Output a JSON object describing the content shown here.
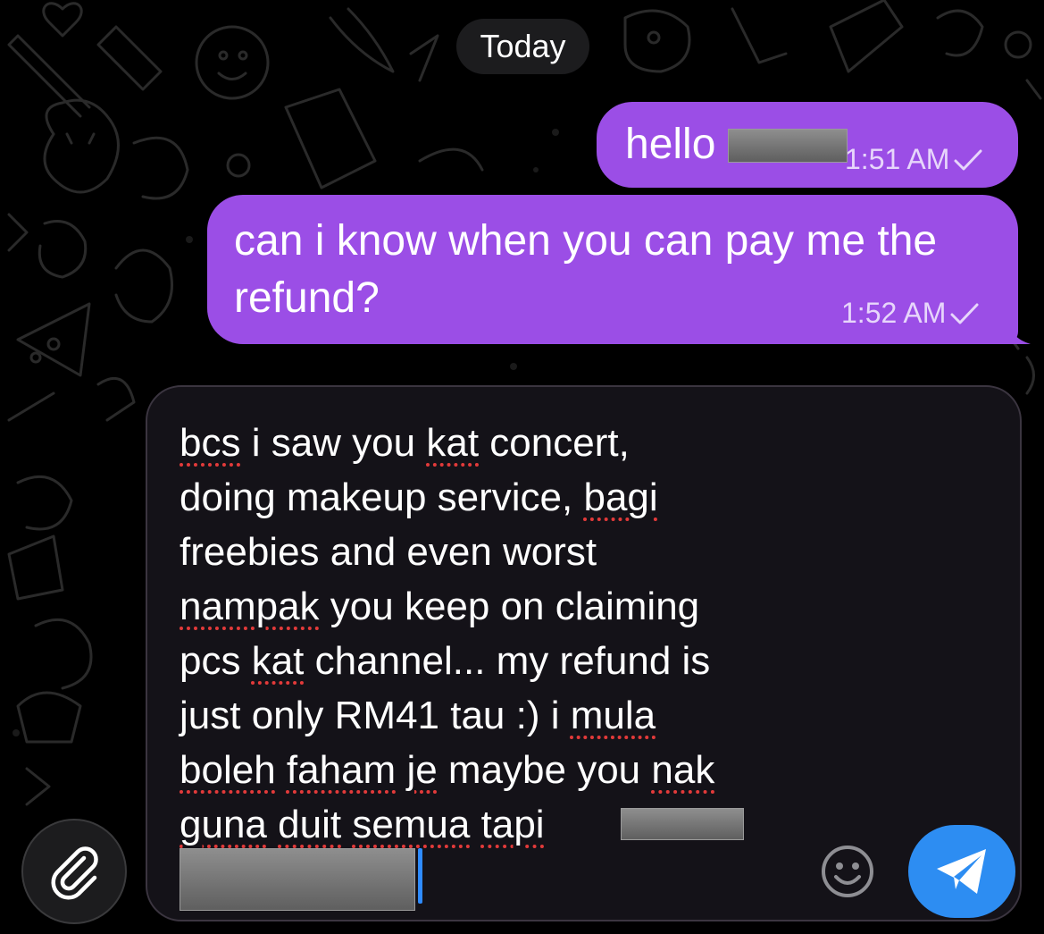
{
  "header": {
    "date_label": "Today"
  },
  "messages": [
    {
      "text": "hello",
      "time": "1:51 AM",
      "status_icon": "check-icon",
      "has_redaction": true
    },
    {
      "text": "can i know when you can pay me the refund?",
      "time": "1:52 AM",
      "status_icon": "check-icon"
    }
  ],
  "composer": {
    "words": [
      "bcs",
      " i saw you ",
      "kat",
      " concert,\ndoing makeup service, ",
      "bagi",
      "\nfreebies and even worst\n",
      "nampak",
      " you keep on claiming\npcs ",
      "kat",
      " channel... my refund is\njust only RM41 tau :) i ",
      "mula",
      "\n",
      "boleh",
      " ",
      "faham",
      " ",
      "je",
      " maybe you ",
      "nak",
      "\n",
      "guna",
      " ",
      "duit",
      " ",
      "semua",
      " ",
      "tapi",
      " "
    ],
    "misspelled": [
      0,
      2,
      4,
      6,
      8,
      10,
      12,
      14,
      16,
      18,
      20,
      22,
      24,
      26
    ],
    "redaction_count": 2
  },
  "controls": {
    "attach_icon": "paperclip-icon",
    "emoji_icon": "smiley-icon",
    "send_icon": "paper-plane-icon"
  },
  "colors": {
    "background": "#000000",
    "outgoing_bubble": "#9b4ee6",
    "composer": "#141218",
    "send_button": "#2d8df2",
    "spellcheck_underline": "#e23a3a"
  }
}
